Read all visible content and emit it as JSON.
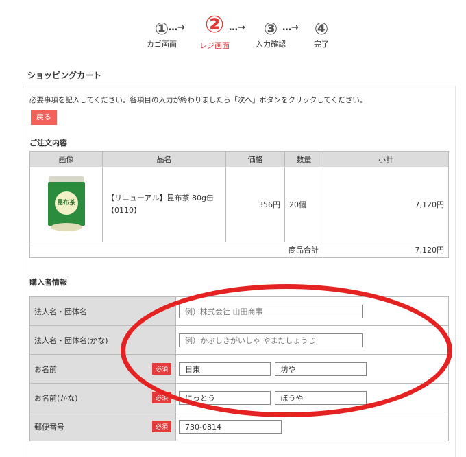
{
  "steps": [
    {
      "num": "①",
      "label": "カゴ画面"
    },
    {
      "num": "②",
      "label": "レジ画面"
    },
    {
      "num": "③",
      "label": "入力確認"
    },
    {
      "num": "④",
      "label": "完了"
    }
  ],
  "arrow": "…→",
  "cart": {
    "title": "ショッピングカート",
    "notice": "必要事項を記入してください。各項目の入力が終わりましたら「次へ」ボタンをクリックしてください。",
    "back_label": "戻る"
  },
  "order": {
    "heading": "ご注文内容",
    "headers": [
      "画像",
      "品名",
      "価格",
      "数量",
      "小計"
    ],
    "item": {
      "image_text": "昆布茶",
      "name": "【リニューアル】昆布茶 80g缶 【0110】",
      "price": "356円",
      "qty": "20個",
      "subtotal": "7,120円"
    },
    "total_label": "商品合計",
    "total_value": "7,120円"
  },
  "buyer": {
    "heading": "購入者情報",
    "required": "必須",
    "company_label": "法人名・団体名",
    "company_placeholder": "例）株式会社 山田商事",
    "company_kana_label": "法人名・団体名(かな)",
    "company_kana_placeholder": "例）かぶしきがいしゃ やまだしょうじ",
    "name_label": "お名前",
    "last_name": "日東",
    "first_name": "坊や",
    "name_kana_label": "お名前(かな)",
    "last_name_kana": "にっとう",
    "first_name_kana": "ぼうや",
    "zip_label": "郵便番号",
    "zip": "730-0814"
  },
  "colors": {
    "accent": "#e03a3a",
    "button": "#f2625a",
    "annotation": "#e52222"
  }
}
